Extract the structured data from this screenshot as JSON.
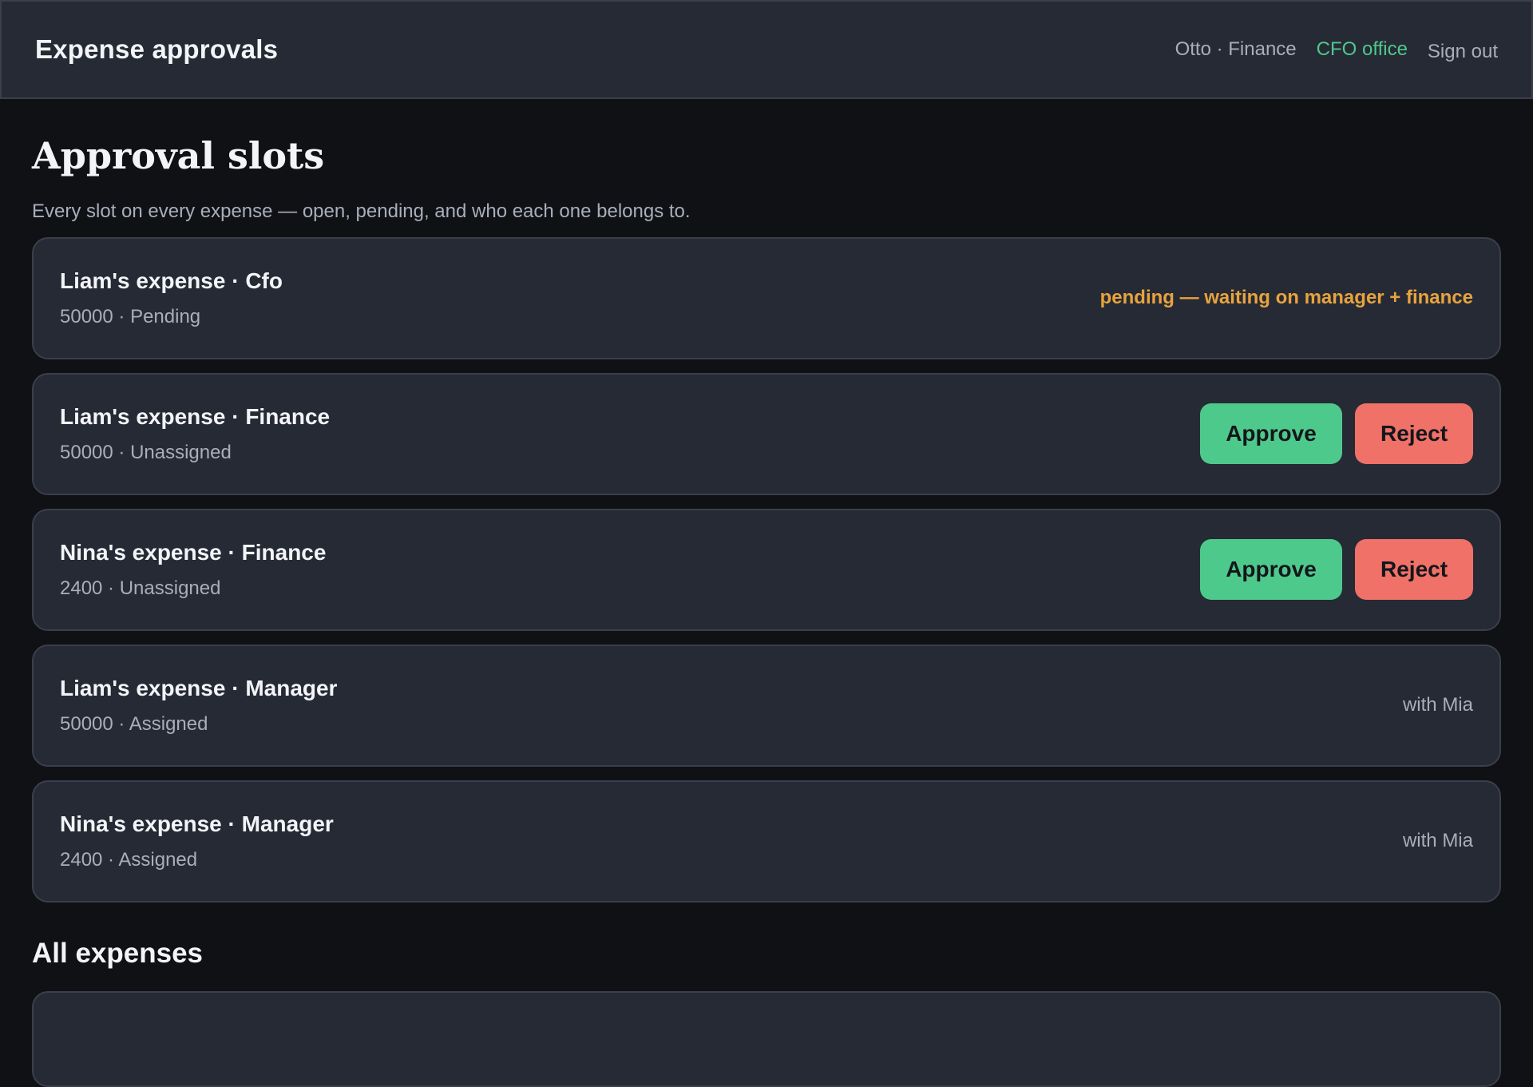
{
  "header": {
    "app_title": "Expense approvals",
    "user": "Otto · Finance",
    "cfo_link": "CFO office",
    "sign_out": "Sign out"
  },
  "main": {
    "title": "Approval slots",
    "subtitle": "Every slot on every expense — open, pending, and who each one belongs to.",
    "slots": [
      {
        "title": "Liam's expense · Cfo",
        "meta": "50000 · Pending",
        "status": "pending — waiting on manager + finance"
      },
      {
        "title": "Liam's expense · Finance",
        "meta": "50000 · Unassigned",
        "approve": "Approve",
        "reject": "Reject"
      },
      {
        "title": "Nina's expense · Finance",
        "meta": "2400 · Unassigned",
        "approve": "Approve",
        "reject": "Reject"
      },
      {
        "title": "Liam's expense · Manager",
        "meta": "50000 · Assigned",
        "status": "with Mia"
      },
      {
        "title": "Nina's expense · Manager",
        "meta": "2400 · Assigned",
        "status": "with Mia"
      }
    ],
    "all_expenses_title": "All expenses"
  },
  "colors": {
    "background": "#0f1115",
    "card": "#262a35",
    "accent_green": "#4ec98c",
    "reject_red": "#ef7167",
    "pending_orange": "#e8a33d"
  }
}
